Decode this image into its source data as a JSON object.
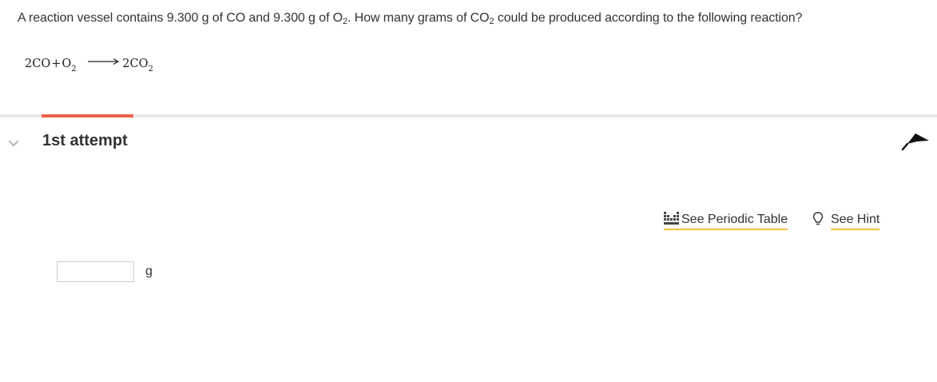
{
  "question": {
    "part1": "A reaction vessel contains 9.300 g of CO and 9.300 g of O",
    "sub1": "2",
    "part2": ". How many grams of CO",
    "sub2": "2",
    "part3": " could be produced according to the following reaction?"
  },
  "equation": {
    "reactant1": "2CO",
    "plus": "+",
    "reactant2": "O",
    "reactant2_sub": "2",
    "product": "2CO",
    "product_sub": "2"
  },
  "attempt": {
    "title": "1st attempt"
  },
  "tools": {
    "periodic_table_label": "See Periodic Table",
    "hint_label": "See Hint"
  },
  "answer": {
    "value": "",
    "unit": "g"
  },
  "colors": {
    "accent_tab": "#f0614a",
    "link_underline": "#f4bf42"
  },
  "icons": {
    "collapse": "chevron-down-icon",
    "flag": "flag-icon",
    "periodic_table": "periodic-table-icon",
    "hint": "lightbulb-icon"
  }
}
